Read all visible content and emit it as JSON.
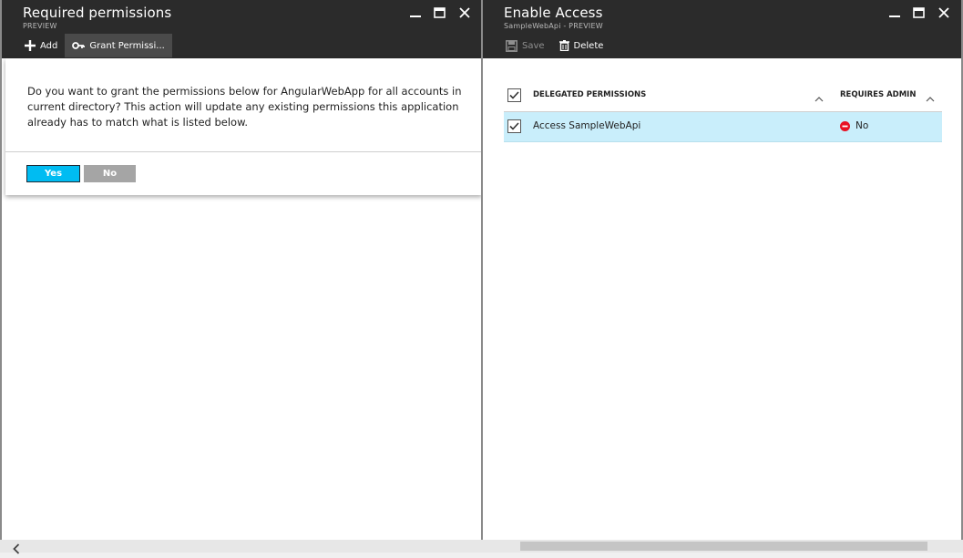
{
  "left_blade": {
    "title": "Required permissions",
    "subtitle": "PREVIEW",
    "commands": {
      "add": "Add",
      "grant": "Grant Permissi..."
    },
    "dialog": {
      "message": "Do you want to grant the permissions below for AngularWebApp for all accounts in current directory? This action will update any existing permissions this application already has to match what is listed below.",
      "yes": "Yes",
      "no": "No"
    }
  },
  "right_blade": {
    "title": "Enable Access",
    "subtitle": "SampleWebApi - PREVIEW",
    "commands": {
      "save": "Save",
      "delete": "Delete"
    },
    "table": {
      "columns": [
        "DELEGATED PERMISSIONS",
        "REQUIRES ADMIN"
      ],
      "rows": [
        {
          "permission": "Access SampleWebApi",
          "requires_admin": "No",
          "checked": true
        }
      ]
    }
  },
  "colors": {
    "header_bg": "#2b2b2b",
    "yes_button": "#00bcf2",
    "no_button": "#a5a5a5",
    "selected_row": "#c9eefb",
    "admin_status_red": "#e81123"
  },
  "icons": {
    "add": "plus-icon",
    "grant": "key-icon",
    "save": "save-icon",
    "delete": "trash-icon",
    "minimize": "minimize-icon",
    "maximize": "maximize-icon",
    "close": "close-icon",
    "sort": "chevron-up-icon",
    "admin_status": "blocked-icon",
    "scroll_left": "chevron-left-icon"
  }
}
